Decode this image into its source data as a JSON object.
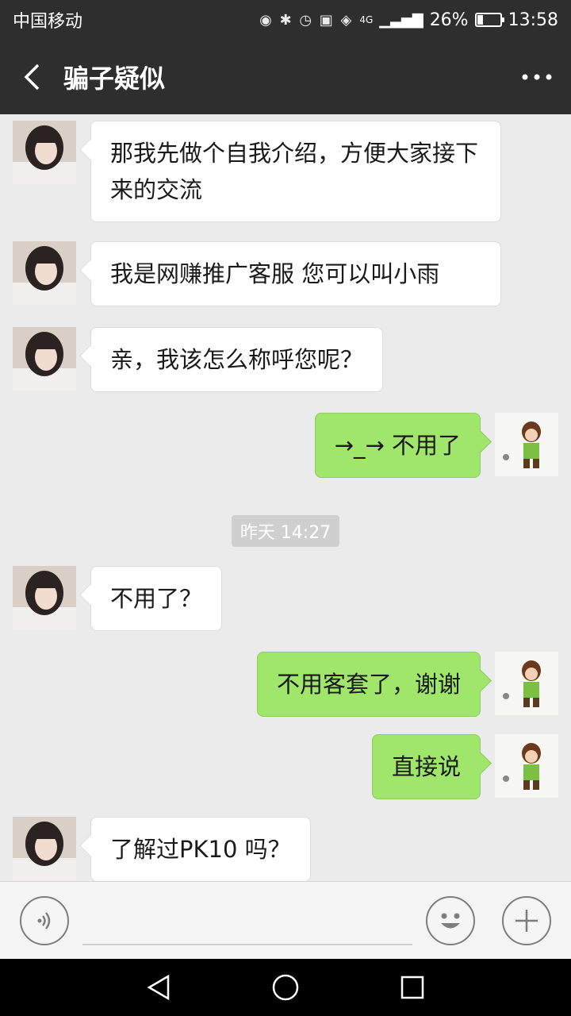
{
  "status_bar": {
    "carrier": "中国移动",
    "network": "4G",
    "battery_percent_text": "26%",
    "battery_level": 0.26,
    "time": "13:58"
  },
  "header": {
    "title": "骗子疑似"
  },
  "chat": {
    "messages": [
      {
        "side": "left",
        "text": "那我先做个自我介绍，方便大家接下来的交流"
      },
      {
        "side": "left",
        "text": "我是网赚推广客服  您可以叫小雨"
      },
      {
        "side": "left",
        "text": "亲，我该怎么称呼您呢？"
      },
      {
        "side": "right",
        "text": "→_→ 不用了"
      },
      {
        "side": "left",
        "text": "不用了？"
      },
      {
        "side": "right",
        "text": "不用客套了，谢谢"
      },
      {
        "side": "right",
        "text": "直接说"
      },
      {
        "side": "left",
        "text": "了解过PK10 吗？"
      }
    ],
    "timestamp": "昨天 14:27"
  },
  "colors": {
    "header_bg": "#2e2e2e",
    "chat_bg": "#ebebeb",
    "sent_bubble": "#9fe66a",
    "received_bubble": "#ffffff"
  },
  "icons": {
    "back": "chevron-left-icon",
    "more": "more-dots-icon",
    "voice": "voice-icon",
    "emoji": "emoji-icon",
    "plus": "plus-icon"
  }
}
